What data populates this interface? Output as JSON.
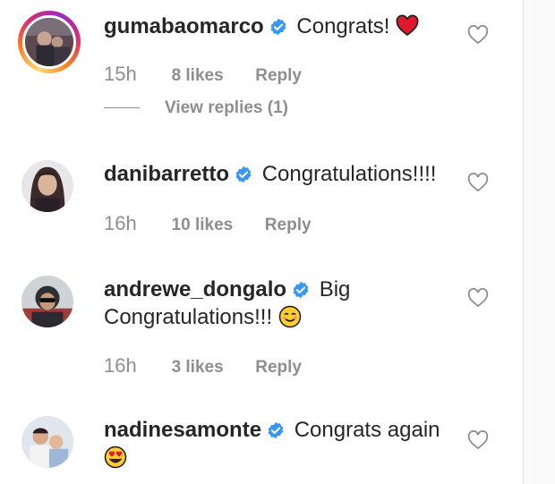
{
  "comments": [
    {
      "username": "gumabaomarco",
      "text": "Congrats!",
      "emoji": "red-heart-emoji",
      "time": "15h",
      "likes": "8 likes",
      "reply": "Reply",
      "has_story": true
    },
    {
      "username": "danibarretto",
      "text": "Congratulations!!!!",
      "time": "16h",
      "likes": "10 likes",
      "reply": "Reply",
      "has_story": false
    },
    {
      "username": "andrewe_dongalo",
      "text": "Big Congratulations!!!",
      "emoji": "smiling-face-emoji",
      "time": "16h",
      "likes": "3 likes",
      "reply": "Reply",
      "has_story": false
    },
    {
      "username": "nadinesamonte",
      "text": "Congrats again",
      "emoji": "heart-eyes-emoji",
      "time": "",
      "likes": "",
      "reply": "",
      "has_story": false
    }
  ],
  "view_replies": "View replies (1)",
  "colors": {
    "text": "#262626",
    "secondary": "#8e8e8e",
    "verified": "#3897f0",
    "heart_emoji": "#e0182d"
  },
  "icons": {
    "verified": "verified-badge-icon",
    "like": "heart-outline-icon"
  }
}
